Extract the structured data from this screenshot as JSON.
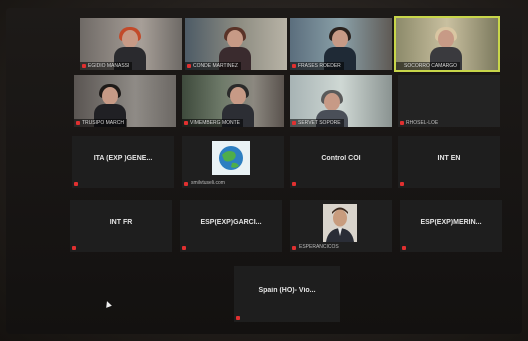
{
  "meeting": {
    "participants": [
      {
        "id": "p1",
        "type": "video",
        "name": "EGIDIO MANASSI",
        "active": false,
        "muted": true
      },
      {
        "id": "p2",
        "type": "video",
        "name": "CONDE MARTINEZ",
        "active": false,
        "muted": true
      },
      {
        "id": "p3",
        "type": "video",
        "name": "FRASES ROEDER",
        "active": false,
        "muted": true
      },
      {
        "id": "p4",
        "type": "video",
        "name": "SOCORRO CAMARGO",
        "active": true,
        "muted": false
      },
      {
        "id": "p5",
        "type": "video",
        "name": "TRUSIPO MARCH",
        "active": false,
        "muted": true
      },
      {
        "id": "p6",
        "type": "video",
        "name": "VIMEMBERG MONTE",
        "active": false,
        "muted": true
      },
      {
        "id": "p7",
        "type": "video",
        "name": "SERVET SOPORE",
        "active": false,
        "muted": true
      },
      {
        "id": "p8",
        "type": "dark",
        "name": "RHOSEL-LOE",
        "active": false,
        "muted": true
      },
      {
        "id": "p9",
        "type": "label",
        "title": "ITA (EXP )GENE...",
        "muted": true
      },
      {
        "id": "p10",
        "type": "avatar",
        "avatar": "globe-logo",
        "name": "smilvtuseli.com",
        "muted": true
      },
      {
        "id": "p11",
        "type": "label",
        "title": "Control COI",
        "muted": true
      },
      {
        "id": "p12",
        "type": "label",
        "title": "INT EN",
        "muted": true
      },
      {
        "id": "p13",
        "type": "label",
        "title": "INT FR",
        "muted": true
      },
      {
        "id": "p14",
        "type": "label",
        "title": "ESP(EXP)GARCI...",
        "muted": true
      },
      {
        "id": "p15",
        "type": "avatar",
        "avatar": "man-portrait",
        "name": "ESPERANCICOS",
        "muted": true
      },
      {
        "id": "p16",
        "type": "label",
        "title": "ESP(EXP)MERIN...",
        "muted": true
      },
      {
        "id": "p17",
        "type": "label",
        "title": "Spain (HO)- Vio...",
        "muted": true
      }
    ]
  },
  "colors": {
    "active_border": "#c8d64a",
    "muted_icon": "#e03030",
    "tile_bg": "#1c1c1c"
  }
}
